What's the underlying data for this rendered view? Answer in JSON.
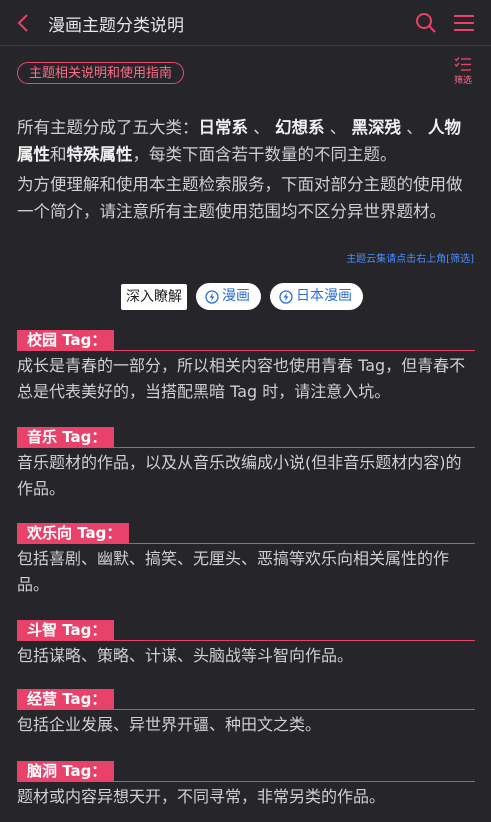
{
  "header": {
    "title": "漫画主题分类说明"
  },
  "guide_pill": "主题相关说明和使用指南",
  "filter_label": "筛选",
  "intro": {
    "p1_prefix": "所有主题分成了五大类：",
    "cat1": "日常系",
    "sep": "、",
    "cat2": "幻想系",
    "cat3": "黑深残",
    "cat4": "人物属性",
    "and": "和",
    "cat5": "特殊属性",
    "p1_suffix": "，每类下面含若干数量的不同主题。",
    "p2": "为方便理解和使用本主题检索服务，下面对部分主题的使用做一个简介，请注意所有主题使用范围均不区分异世界题材。"
  },
  "note": "主题云集请点击右上角[筛选]",
  "chips": {
    "deep": "深入瞭解",
    "manga": "漫画",
    "jp_manga": "日本漫画"
  },
  "sections": [
    {
      "tag": "校园 Tag：",
      "desc": "成长是青春的一部分，所以相关内容也使用青春 Tag，但青春不总是代表美好的，当搭配黑暗 Tag 时，请注意入坑。"
    },
    {
      "tag": "音乐 Tag：",
      "desc": "音乐题材的作品，以及从音乐改编成小说(但非音乐题材内容)的作品。"
    },
    {
      "tag": "欢乐向 Tag：",
      "desc": "包括喜剧、幽默、搞笑、无厘头、恶搞等欢乐向相关属性的作品。"
    },
    {
      "tag": "斗智 Tag：",
      "desc": "包括谋略、策略、计谋、头脑战等斗智向作品。"
    },
    {
      "tag": "经营 Tag：",
      "desc": "包括企业发展、异世界开疆、种田文之类。"
    },
    {
      "tag": "脑洞 Tag：",
      "desc": "题材或内容异想天开，不同寻常，非常另类的作品。"
    }
  ]
}
